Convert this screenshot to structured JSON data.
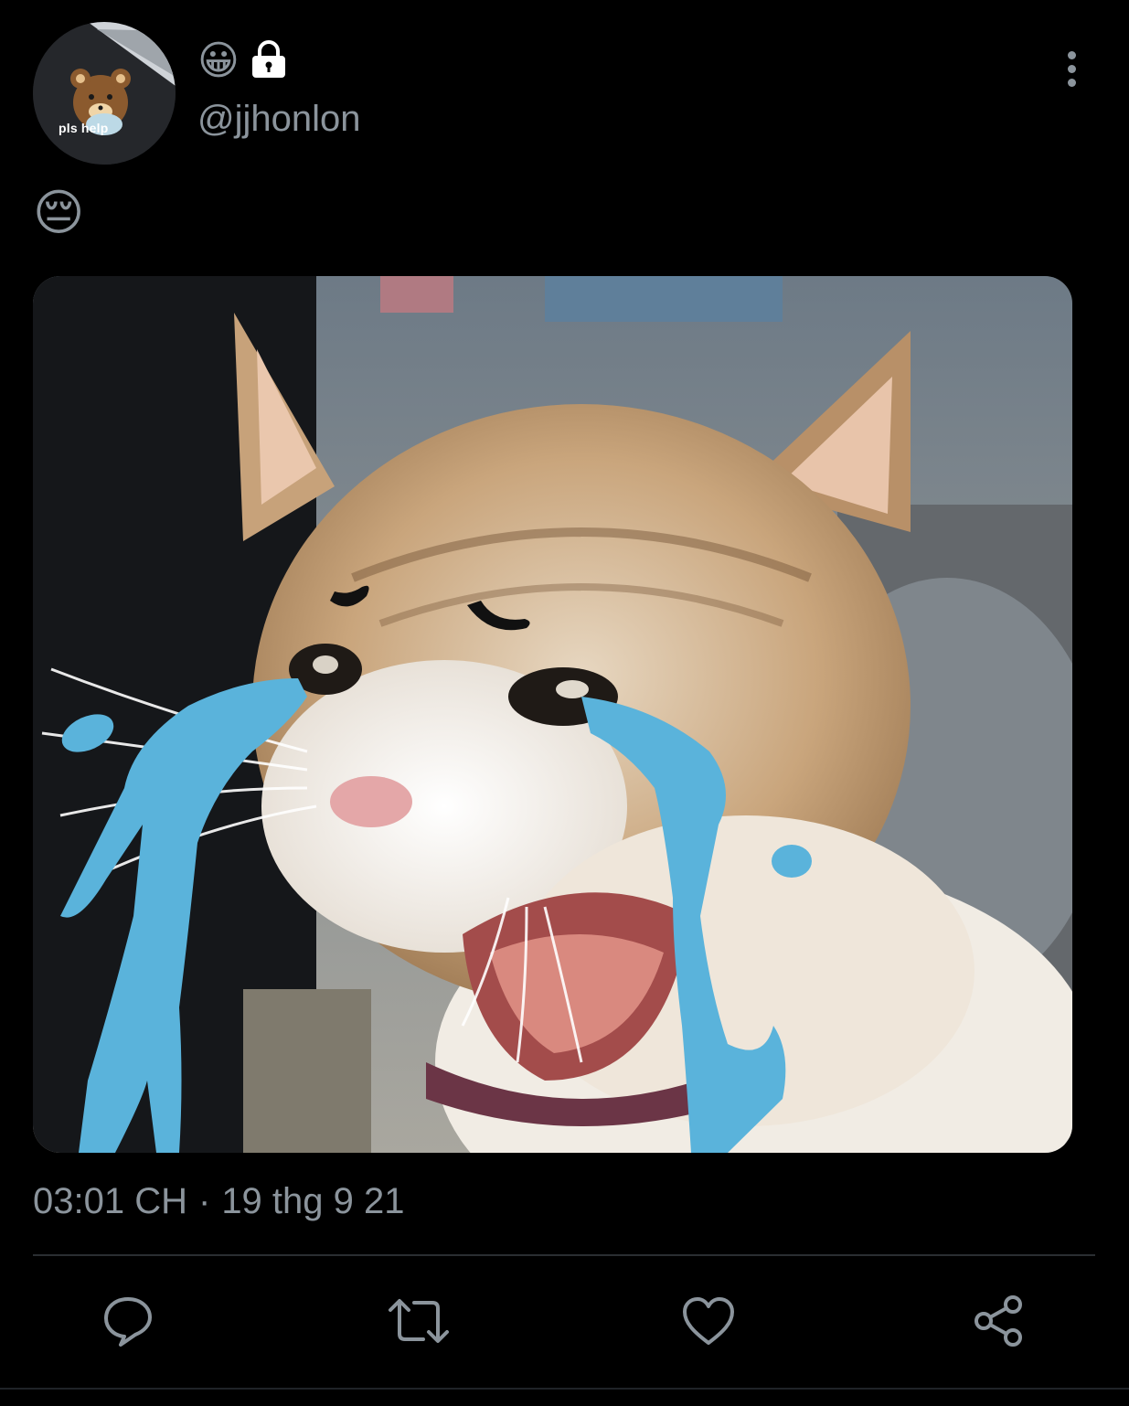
{
  "tweet": {
    "display_name_emojis": [
      "😀",
      "🔒"
    ],
    "handle": "@jjhonlon",
    "avatar_text": "pls help",
    "text": "😔",
    "timestamp": "03:01 CH",
    "separator": "·",
    "date": "19 thg 9 21"
  },
  "icons": {
    "more": "more-vertical-icon",
    "reply": "reply-icon",
    "retweet": "retweet-icon",
    "like": "heart-icon",
    "share": "share-icon"
  },
  "colors": {
    "background": "#000000",
    "secondary_text": "#8b949c",
    "tear_blue": "#5ab3db"
  }
}
